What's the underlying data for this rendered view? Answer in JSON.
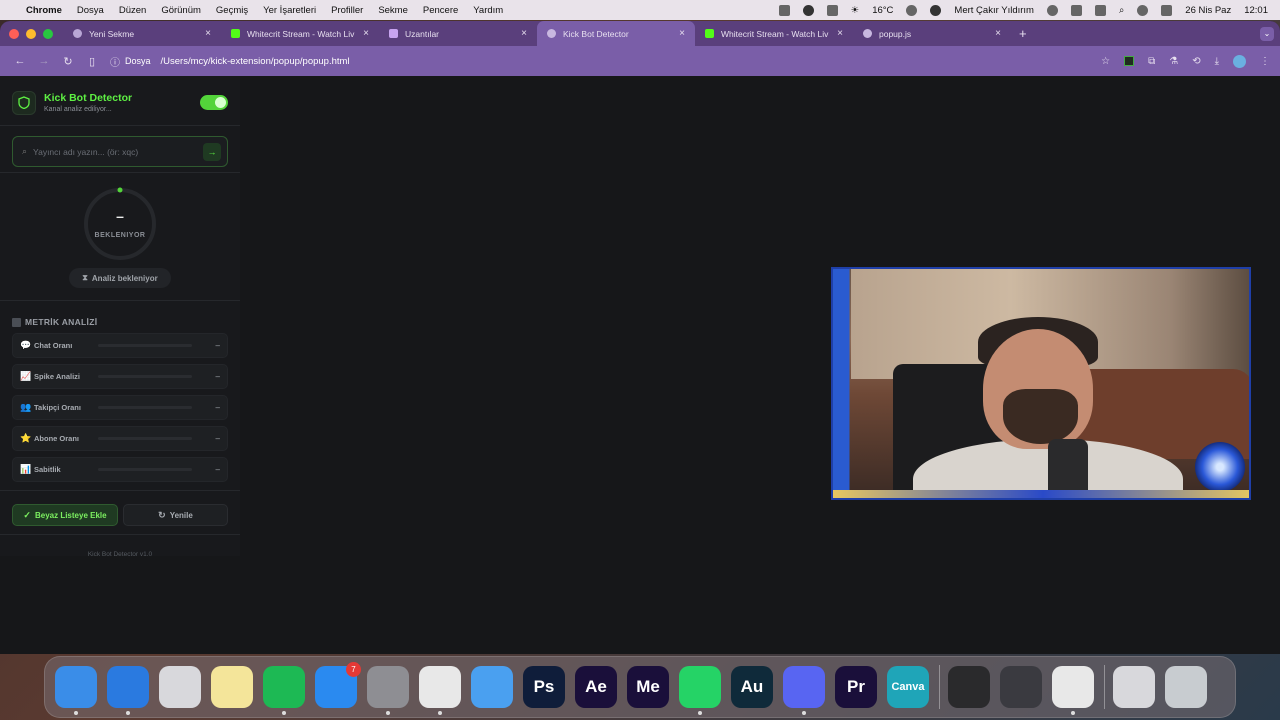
{
  "menubar": {
    "app": "Chrome",
    "items": [
      "Dosya",
      "Düzen",
      "Görünüm",
      "Geçmiş",
      "Yer İşaretleri",
      "Profiller",
      "Sekme",
      "Pencere",
      "Yardım"
    ],
    "weather": "16°C",
    "user": "Mert Çakır Yıldırım",
    "date": "26 Nis Paz",
    "time": "12:01"
  },
  "tabs": [
    {
      "title": "Yeni Sekme",
      "favicon_color": "#b9a6d6"
    },
    {
      "title": "Whitecrit Stream - Watch Liv",
      "favicon_color": "#53fc18"
    },
    {
      "title": "Uzantılar",
      "favicon_color": "#c8a4f0"
    },
    {
      "title": "Kick Bot Detector",
      "favicon_color": "#c8b8e0"
    },
    {
      "title": "Whitecrit Stream - Watch Liv",
      "favicon_color": "#53fc18"
    },
    {
      "title": "popup.js",
      "favicon_color": "#c8b8e0"
    }
  ],
  "address": {
    "scheme": "Dosya",
    "url": "/Users/mcy/kick-extension/popup/popup.html"
  },
  "popup": {
    "title": "Kick Bot Detector",
    "subtitle": "Kanal analiz ediliyor...",
    "search_placeholder": "Yayıncı adı yazın... (ör: xqc)",
    "score": "–",
    "status": "BEKLENIYOR",
    "analysis_pill": "Analiz bekleniyor",
    "metrics_heading": "METRİK ANALİZİ",
    "metrics": [
      {
        "label": "Chat Oranı",
        "value": "–",
        "icon": "speech-bubble-icon",
        "glyph": "💬"
      },
      {
        "label": "Spike Analizi",
        "value": "–",
        "icon": "chart-icon",
        "glyph": "📈"
      },
      {
        "label": "Takipçi Oranı",
        "value": "–",
        "icon": "people-icon",
        "glyph": "👥"
      },
      {
        "label": "Abone Oranı",
        "value": "–",
        "icon": "star-icon",
        "glyph": "⭐"
      },
      {
        "label": "Sabitlik",
        "value": "–",
        "icon": "bar-chart-icon",
        "glyph": "📊"
      }
    ],
    "whitelist_button": "Beyaz Listeye Ekle",
    "refresh_button": "Yenile",
    "footer": "Kick Bot Detector v1.0"
  },
  "dock": {
    "appstore_badge": "7",
    "items": [
      {
        "name": "finder",
        "label": "",
        "color": "#3a8de8"
      },
      {
        "name": "safari",
        "label": "",
        "color": "#2a7ae0"
      },
      {
        "name": "launchpad",
        "label": "",
        "color": "#d8d8dc"
      },
      {
        "name": "notes",
        "label": "",
        "color": "#f4e59a"
      },
      {
        "name": "spotify",
        "label": "",
        "color": "#1db954"
      },
      {
        "name": "app-store",
        "label": "",
        "color": "#2a8af0"
      },
      {
        "name": "system-settings",
        "label": "",
        "color": "#8e8e93"
      },
      {
        "name": "chrome",
        "label": "",
        "color": "#e8e8e8"
      },
      {
        "name": "mail",
        "label": "",
        "color": "#4aa0f0"
      },
      {
        "name": "photoshop",
        "label": "Ps",
        "color": "#0f1d3a"
      },
      {
        "name": "after-effects",
        "label": "Ae",
        "color": "#1a0f3a"
      },
      {
        "name": "media-encoder",
        "label": "Me",
        "color": "#1a0f3a"
      },
      {
        "name": "whatsapp",
        "label": "",
        "color": "#25d366"
      },
      {
        "name": "audition",
        "label": "Au",
        "color": "#0f2a3a"
      },
      {
        "name": "discord",
        "label": "",
        "color": "#5865f2"
      },
      {
        "name": "premiere",
        "label": "Pr",
        "color": "#1a0f3a"
      },
      {
        "name": "canva",
        "label": "Canva",
        "color": "#1fa5b8"
      },
      {
        "name": "capcut",
        "label": "",
        "color": "#2a2a2c"
      },
      {
        "name": "instruments",
        "label": "",
        "color": "#3a3a40"
      },
      {
        "name": "chrome-2",
        "label": "",
        "color": "#e8e8e8"
      },
      {
        "name": "downloads",
        "label": "",
        "color": "#d8d8dc"
      },
      {
        "name": "trash",
        "label": "",
        "color": "#c8ccd0"
      }
    ]
  }
}
